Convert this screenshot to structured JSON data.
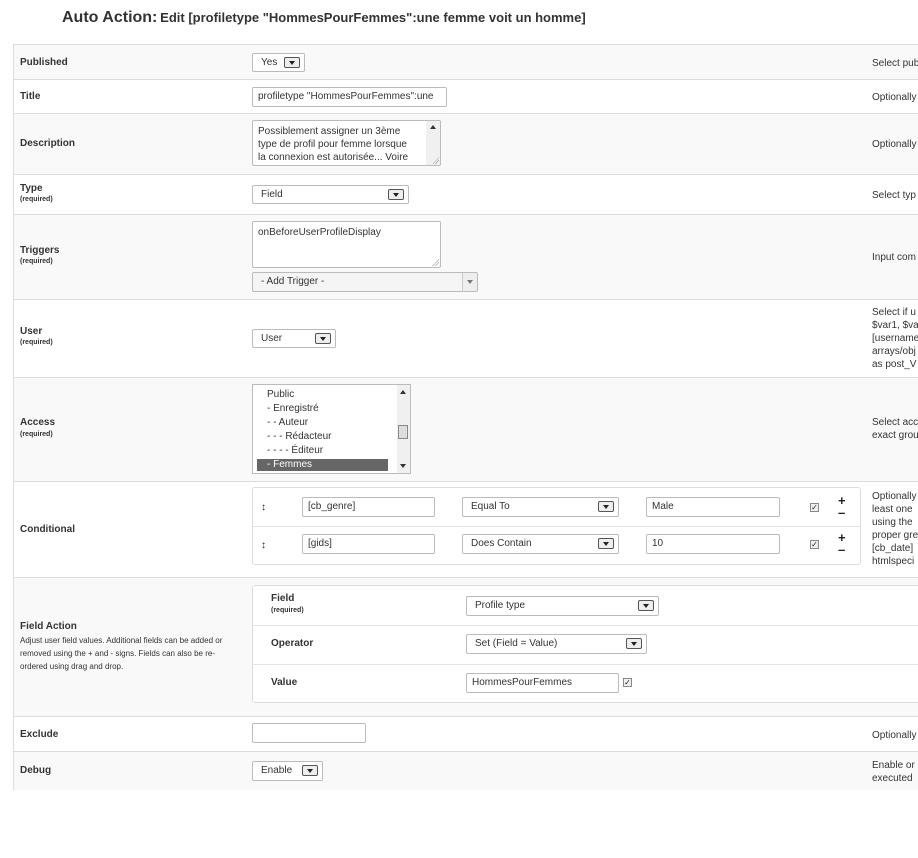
{
  "header": {
    "title": "Auto Action:",
    "subtitle": "Edit [profiletype \"HommesPourFemmes\":une femme voit un homme]"
  },
  "required_label": "(required)",
  "published": {
    "label": "Published",
    "value": "Yes",
    "help": "Select pub"
  },
  "title": {
    "label": "Title",
    "value": "profiletype \"HommesPourFemmes\":une",
    "help": "Optionally"
  },
  "description": {
    "label": "Description",
    "lines": [
      "Possiblement assigner un 3ème",
      "type de profil pour femme lorsque",
      "la connexion est autorisée... Voire"
    ],
    "help": "Optionally"
  },
  "type": {
    "label": "Type",
    "value": "Field",
    "help": "Select typ"
  },
  "triggers": {
    "label": "Triggers",
    "value": "onBeforeUserProfileDisplay",
    "add_placeholder": "- Add Trigger -",
    "help": "Input com"
  },
  "user": {
    "label": "User",
    "value": "User",
    "help_lines": [
      "Select if u",
      "$var1, $va",
      "[username",
      "arrays/obj",
      "as post_V"
    ]
  },
  "access": {
    "label": "Access",
    "options": [
      "Public",
      "- Enregistré",
      "- - Auteur",
      "- - - Rédacteur",
      "- - - - Éditeur",
      "- Femmes"
    ],
    "selected_index": 5,
    "help_lines": [
      "Select acc",
      "exact grou"
    ]
  },
  "conditional": {
    "label": "Conditional",
    "rows": [
      {
        "field": "[cb_genre]",
        "operator": "Equal To",
        "value": "Male",
        "checked": true
      },
      {
        "field": "[gids]",
        "operator": "Does Contain",
        "value": "10",
        "checked": true
      }
    ],
    "add_symbol": "+",
    "remove_symbol": "–",
    "move_symbol": "↕",
    "help_lines": [
      "Optionally",
      "least one",
      "using the",
      "proper gre",
      "[cb_date]",
      "htmlspeci"
    ]
  },
  "field_action": {
    "label": "Field Action",
    "help_lines": [
      "Adjust user field values. Additional fields can be added or",
      "removed using the + and - signs. Fields can also be re-",
      "ordered using drag and drop."
    ],
    "field_label": "Field",
    "field_value": "Profile type",
    "operator_label": "Operator",
    "operator_value": "Set (Field = Value)",
    "value_label": "Value",
    "value_value": "HommesPourFemmes",
    "value_checked": true
  },
  "exclude": {
    "label": "Exclude",
    "value": "",
    "help": "Optionally"
  },
  "debug": {
    "label": "Debug",
    "value": "Enable",
    "help_lines": [
      "Enable or",
      "executed"
    ]
  },
  "icons": {
    "dropdown": "chevron-down-icon",
    "move": "drag-handle-icon",
    "add": "plus-icon",
    "remove": "minus-icon",
    "checkbox": "checkbox-icon"
  }
}
